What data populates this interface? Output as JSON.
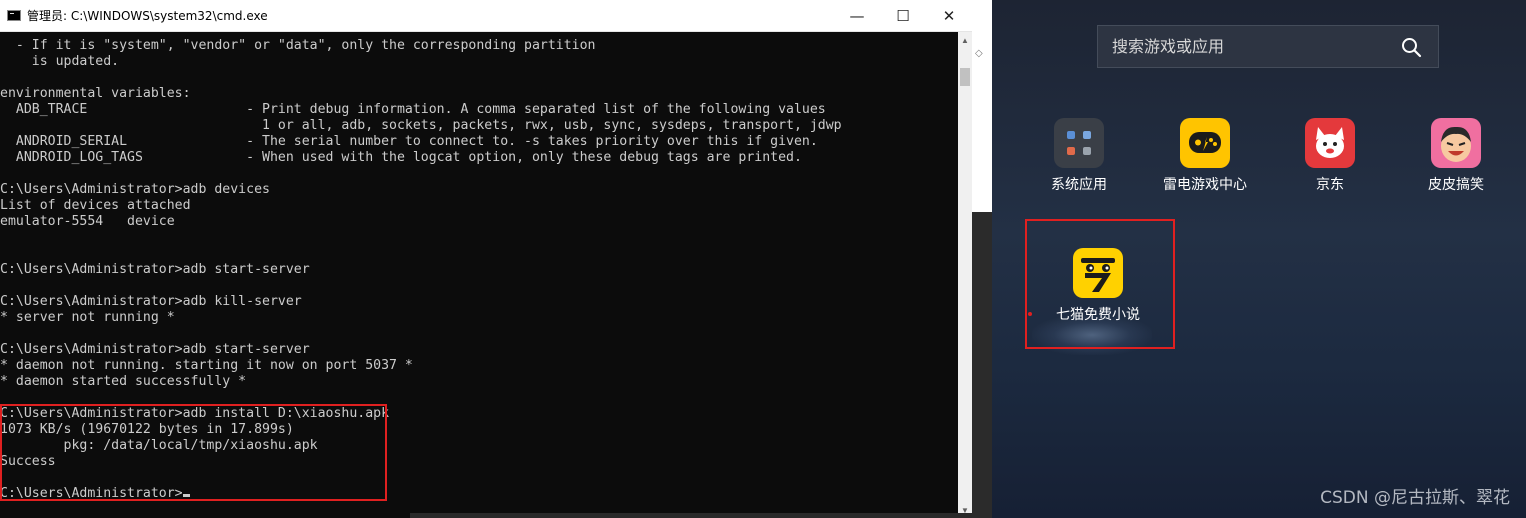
{
  "cmd_window": {
    "title": "管理员: C:\\WINDOWS\\system32\\cmd.exe",
    "controls": {
      "minimize": "—",
      "maximize": "☐",
      "close": "✕"
    },
    "lines": [
      "  - If it is \"system\", \"vendor\" or \"data\", only the corresponding partition",
      "    is updated.",
      "",
      "environmental variables:",
      "  ADB_TRACE                    - Print debug information. A comma separated list of the following values",
      "                                 1 or all, adb, sockets, packets, rwx, usb, sync, sysdeps, transport, jdwp",
      "  ANDROID_SERIAL               - The serial number to connect to. -s takes priority over this if given.",
      "  ANDROID_LOG_TAGS             - When used with the logcat option, only these debug tags are printed.",
      "",
      "C:\\Users\\Administrator>adb devices",
      "List of devices attached",
      "emulator-5554   device",
      "",
      "",
      "C:\\Users\\Administrator>adb start-server",
      "",
      "C:\\Users\\Administrator>adb kill-server",
      "* server not running *",
      "",
      "C:\\Users\\Administrator>adb start-server",
      "* daemon not running. starting it now on port 5037 *",
      "* daemon started successfully *",
      "",
      "C:\\Users\\Administrator>adb install D:\\xiaoshu.apk",
      "1073 KB/s (19670122 bytes in 17.899s)",
      "        pkg: /data/local/tmp/xiaoshu.apk",
      "Success",
      ""
    ],
    "prompt": "C:\\Users\\Administrator>"
  },
  "emulator": {
    "search_placeholder": "搜索游戏或应用",
    "apps": [
      {
        "label": "系统应用"
      },
      {
        "label": "雷电游戏中心"
      },
      {
        "label": "京东"
      },
      {
        "label": "皮皮搞笑"
      },
      {
        "label": "七猫免费小说"
      }
    ]
  },
  "watermark": "CSDN @尼古拉斯、翠花",
  "colors": {
    "terminal_bg": "#0c0c0c",
    "terminal_fg": "#cccccc",
    "highlight": "#e02020"
  }
}
